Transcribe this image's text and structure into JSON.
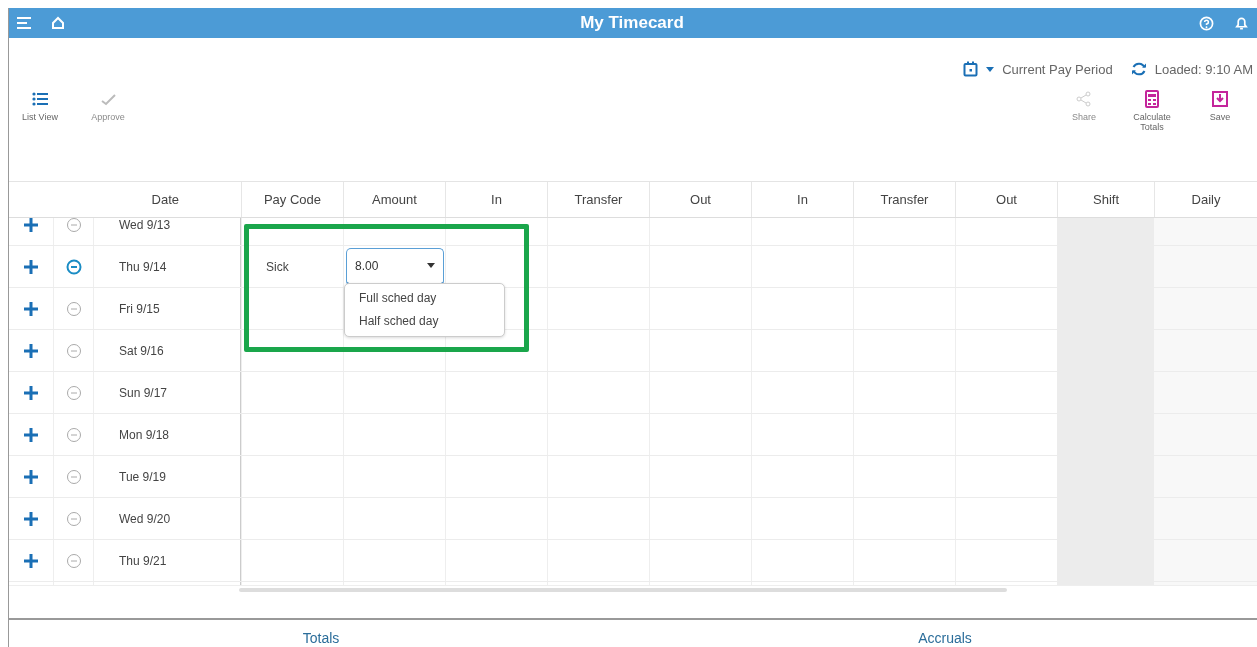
{
  "window": {
    "title": "My Timecard"
  },
  "period": {
    "label": "Current Pay Period",
    "loaded": "Loaded: 9:10 AM"
  },
  "left_actions": [
    {
      "label": "List View",
      "disabled": false
    },
    {
      "label": "Approve",
      "disabled": true
    }
  ],
  "right_actions": [
    {
      "label": "Share",
      "disabled": true
    },
    {
      "label": "Calculate Totals",
      "disabled": false
    },
    {
      "label": "Save",
      "disabled": false
    }
  ],
  "columns": [
    {
      "label": "Date",
      "kind": "date"
    },
    {
      "label": "Pay Code",
      "kind": "data"
    },
    {
      "label": "Amount",
      "kind": "data"
    },
    {
      "label": "In",
      "kind": "data"
    },
    {
      "label": "Transfer",
      "kind": "data"
    },
    {
      "label": "Out",
      "kind": "data"
    },
    {
      "label": "In",
      "kind": "data"
    },
    {
      "label": "Transfer",
      "kind": "data"
    },
    {
      "label": "Out",
      "kind": "data"
    },
    {
      "label": "Shift",
      "kind": "summary"
    },
    {
      "label": "Daily",
      "kind": "summary"
    }
  ],
  "rows": [
    {
      "date": "Wed 9/13",
      "selected": false
    },
    {
      "date": "Thu 9/14",
      "selected": true,
      "pay_code": "Sick",
      "amount": "8.00"
    },
    {
      "date": "Fri 9/15",
      "selected": false
    },
    {
      "date": "Sat 9/16",
      "selected": false
    },
    {
      "date": "Sun 9/17",
      "selected": false
    },
    {
      "date": "Mon 9/18",
      "selected": false
    },
    {
      "date": "Tue 9/19",
      "selected": false
    },
    {
      "date": "Wed 9/20",
      "selected": false
    },
    {
      "date": "Thu 9/21",
      "selected": false
    }
  ],
  "amount_options": [
    "Full sched day",
    "Half sched day"
  ],
  "bottom_tabs": [
    "Totals",
    "Accruals"
  ]
}
